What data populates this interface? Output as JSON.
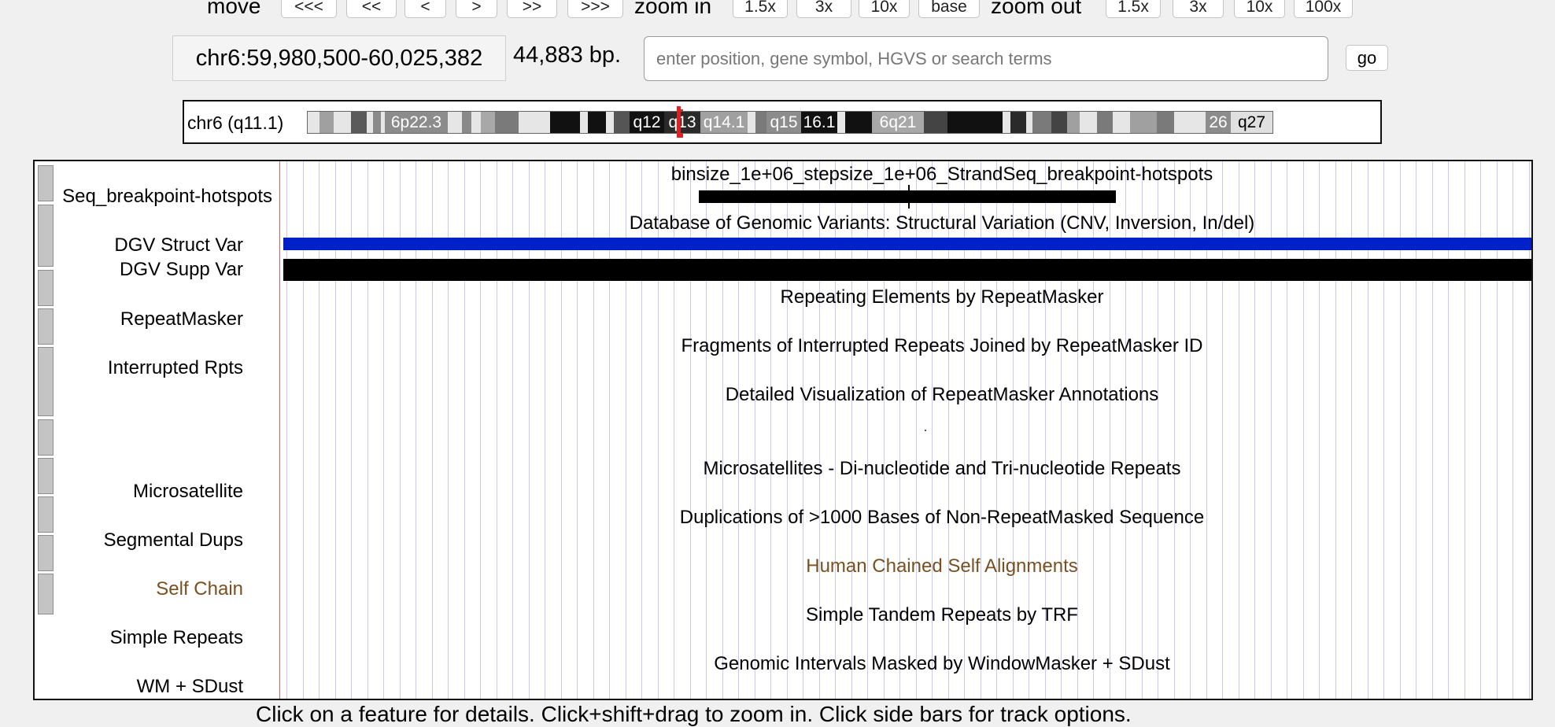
{
  "nav": {
    "move_label": "move",
    "move_buttons": [
      "<<<",
      "<<",
      "<",
      ">",
      ">>",
      ">>>"
    ],
    "zoom_in_label": "zoom in",
    "zoom_in_buttons": [
      "1.5x",
      "3x",
      "10x",
      "base"
    ],
    "zoom_out_label": "zoom out",
    "zoom_out_buttons": [
      "1.5x",
      "3x",
      "10x",
      "100x"
    ]
  },
  "position": {
    "coords": "chr6:59,980,500-60,025,382",
    "size": "44,883 bp.",
    "search_placeholder": "enter position, gene symbol, HGVS or search terms",
    "go_label": "go"
  },
  "ideogram": {
    "label": "chr6 (q11.1)",
    "band_labels": [
      "6p22.3",
      "q12",
      "q13",
      "q14.1",
      "q15",
      "16.1",
      "6q21",
      "26",
      "q27"
    ],
    "centromere_color": "#e02020"
  },
  "tracks": {
    "strandseq": {
      "label": "Seq_breakpoint-hotspots",
      "title": "binsize_1e+06_stepsize_1e+06_StrandSeq_breakpoint-hotspots"
    },
    "dgv": {
      "title": "Database of Genomic Variants: Structural Variation (CNV, Inversion, In/del)",
      "struct_label": "DGV Struct Var",
      "supp_label": "DGV Supp Var",
      "struct_color": "#0020c8"
    },
    "repeatmasker": {
      "label": "RepeatMasker",
      "title": "Repeating Elements by RepeatMasker"
    },
    "interrupted": {
      "label": "Interrupted Rpts",
      "title": "Fragments of Interrupted Repeats Joined by RepeatMasker ID"
    },
    "rmviz": {
      "title": "Detailed Visualization of RepeatMasker Annotations"
    },
    "microsat": {
      "label": "Microsatellite",
      "title": "Microsatellites - Di-nucleotide and Tri-nucleotide Repeats"
    },
    "segdups": {
      "label": "Segmental Dups",
      "title": "Duplications of >1000 Bases of Non-RepeatMasked Sequence"
    },
    "selfchain": {
      "label": "Self Chain",
      "title": "Human Chained Self Alignments",
      "color": "#7a5020"
    },
    "simplerepeats": {
      "label": "Simple Repeats",
      "title": "Simple Tandem Repeats by TRF"
    },
    "wmsdust": {
      "label": "WM + SDust",
      "title": "Genomic Intervals Masked by WindowMasker + SDust"
    }
  },
  "footer_text": "Click on a feature for details. Click+shift+drag to zoom in. Click side bars for track options."
}
